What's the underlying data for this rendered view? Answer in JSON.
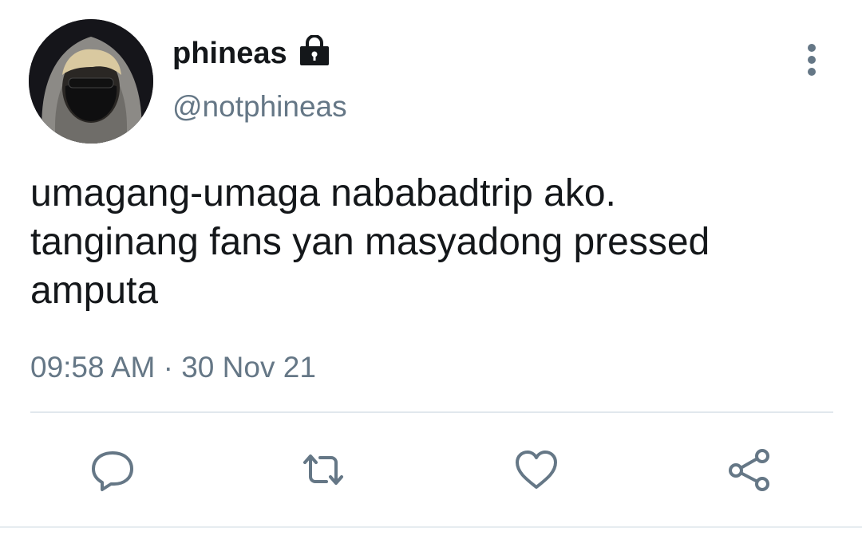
{
  "user": {
    "display_name": "phineas",
    "handle": "@notphineas",
    "protected_icon": "lock-icon",
    "avatar": "avatar-photo"
  },
  "tweet": {
    "lines": [
      "umagang-umaga nababadtrip ako.",
      "tanginang fans yan masyadong pressed",
      "amputa"
    ],
    "time": "09:58 AM",
    "separator": "·",
    "date": "30 Nov 21"
  },
  "actions": [
    {
      "name": "reply",
      "icon": "comment-icon"
    },
    {
      "name": "retweet",
      "icon": "retweet-icon"
    },
    {
      "name": "like",
      "icon": "heart-icon"
    },
    {
      "name": "share",
      "icon": "share-icon"
    }
  ],
  "colors": {
    "text": "#14171a",
    "secondary": "#657786",
    "icon": "#657786",
    "divider": "#e1e8ed"
  }
}
